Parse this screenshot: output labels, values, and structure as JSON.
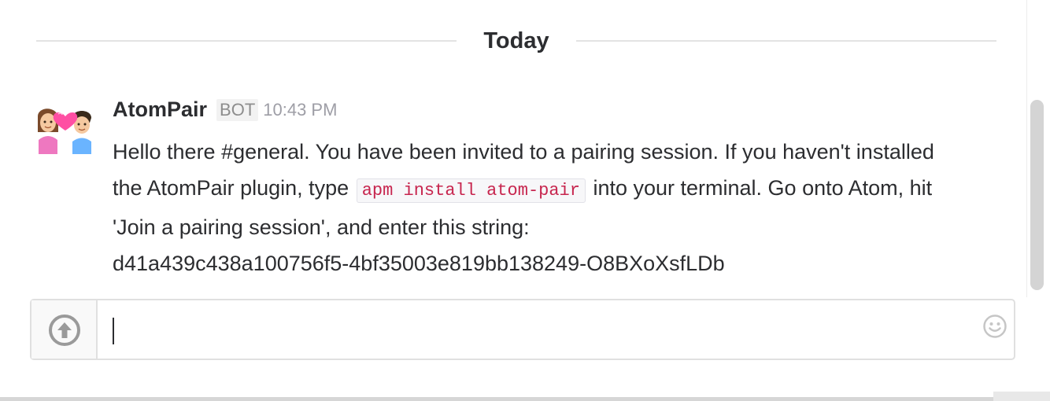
{
  "divider": {
    "label": "Today"
  },
  "message": {
    "sender": "AtomPair",
    "badge": "BOT",
    "time": "10:43 PM",
    "avatar_icon": "couple-with-heart-emoji",
    "text_part1": "Hello there #general. You have been invited to a pairing session. If you haven't installed the AtomPair plugin, type",
    "code": "apm install atom-pair",
    "text_part2": "into your terminal. Go onto Atom, hit 'Join a pairing session', and enter this string:",
    "session_token": "d41a439c438a100756f5-4bf35003e819bb138249-O8BXoXsfLDb"
  },
  "composer": {
    "upload_icon": "upload-arrow-icon",
    "emoji_icon": "smiley-icon",
    "input_value": "",
    "placeholder": ""
  },
  "colors": {
    "text": "#2c2d30",
    "muted": "#9e9ea6",
    "code_text": "#c7254e",
    "border": "#e0e0e0"
  }
}
